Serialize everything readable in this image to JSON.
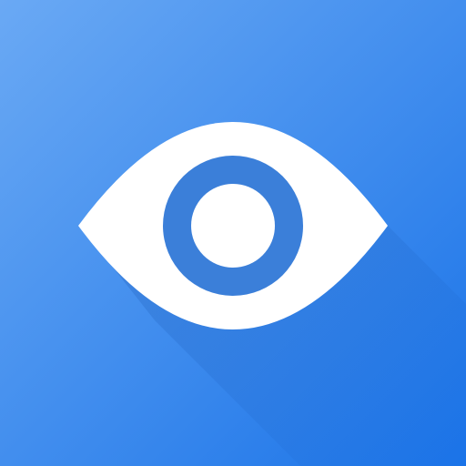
{
  "icon": {
    "name": "eye-icon",
    "colors": {
      "background_light": "#6aa9f4",
      "background_dark": "#1a73e8",
      "eye_white": "#ffffff",
      "iris": "#3b7fd9",
      "shadow": "#1a5fc4"
    }
  }
}
